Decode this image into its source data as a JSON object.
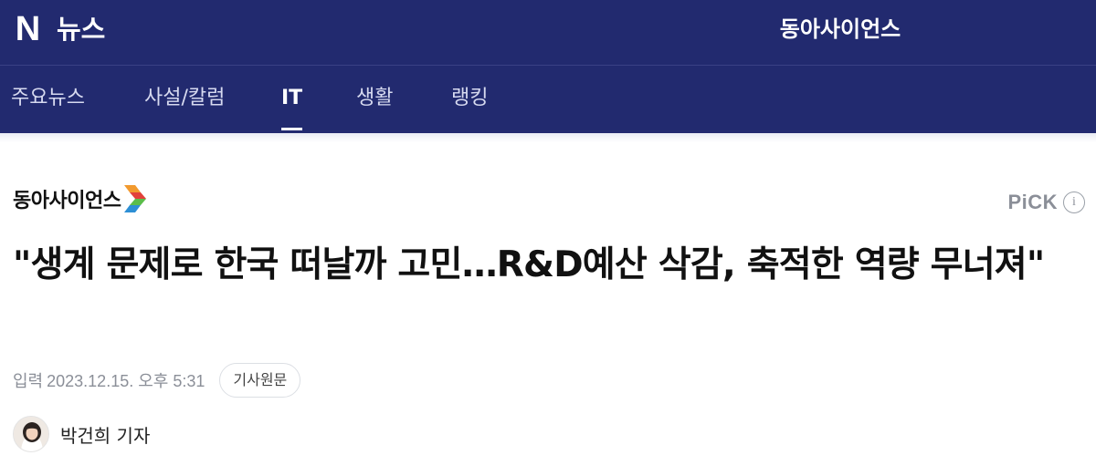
{
  "header": {
    "logo_letter": "N",
    "service_name": "뉴스",
    "press_name": "동아사이언스"
  },
  "tabs": [
    {
      "label": "주요뉴스",
      "active": false
    },
    {
      "label": "사설/칼럼",
      "active": false
    },
    {
      "label": "IT",
      "active": true
    },
    {
      "label": "생활",
      "active": false
    },
    {
      "label": "랭킹",
      "active": false
    }
  ],
  "article": {
    "press_logo_text": "동아사이언스",
    "pick_label": "PiCK",
    "pick_info_icon": "i",
    "title": "\"생계 문제로 한국 떠날까 고민…R&D예산 삭감, 축적한 역량 무너져\"",
    "published_label": "입력",
    "published_date": "2023.12.15. 오후 5:31",
    "original_button": "기사원문",
    "reporter": "박건희 기자"
  },
  "colors": {
    "header_bg": "#222a6f",
    "tab_active": "#ffffff",
    "tab_inactive": "#d7daf0",
    "meta_text": "#8b8f98"
  }
}
